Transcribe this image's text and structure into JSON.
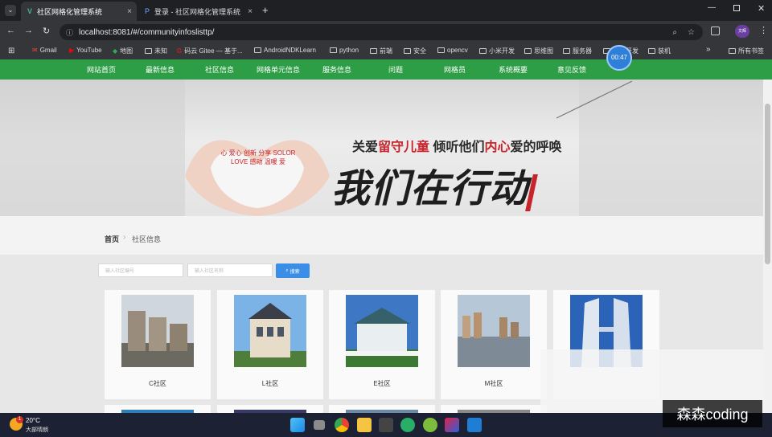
{
  "browser": {
    "tabs": [
      {
        "title": "社区网格化管理系统",
        "active": true
      },
      {
        "title": "登录 - 社区网格化管理系统",
        "active": false
      }
    ],
    "new_tab": "+",
    "close_glyph": "×",
    "url": "localhost:8081/#/communityinfoslisttp/",
    "timer": "00:47",
    "profile_label": "文辉",
    "bookmarks": [
      "Gmail",
      "YouTube",
      "地图",
      "未知",
      "码云 Gitee — 基于...",
      "AndroidNDKLearn",
      "python",
      "前端",
      "安全",
      "opencv",
      "小米开发",
      "思维图",
      "服务器",
      "微信开发",
      "装机"
    ],
    "all_bookmarks": "所有书签",
    "more": "»"
  },
  "site_nav": [
    "网站首页",
    "最新信息",
    "社区信息",
    "网格单元信息",
    "服务信息",
    "问题",
    "网格员",
    "系统概要",
    "意见反馈"
  ],
  "banner": {
    "line1_a": "关爱",
    "line1_b": "留守儿童",
    "line1_c": " 倾听他们",
    "line1_d": "内心",
    "line1_e": "爱的呼唤",
    "line2": "我们在行动",
    "heart_words": [
      "心",
      "爱心",
      "创新",
      "分享",
      "SOLOR",
      "LOVE",
      "感动",
      "温暖",
      "爱"
    ],
    "colors": {
      "red": "#c8242b",
      "dark": "#2a2a2a"
    }
  },
  "breadcrumb": {
    "home": "首页",
    "current": "社区信息",
    "separator": "›"
  },
  "search": {
    "code_placeholder": "输入社区编号",
    "name_placeholder": "输入社区名称",
    "button": "搜索"
  },
  "communities": [
    {
      "name": "C社区"
    },
    {
      "name": "L社区"
    },
    {
      "name": "E社区"
    },
    {
      "name": "M社区"
    },
    {
      "name": ""
    }
  ],
  "taskbar": {
    "temperature": "20°C",
    "weather": "大部晴朗",
    "badge": "1"
  },
  "watermark": "森森coding"
}
